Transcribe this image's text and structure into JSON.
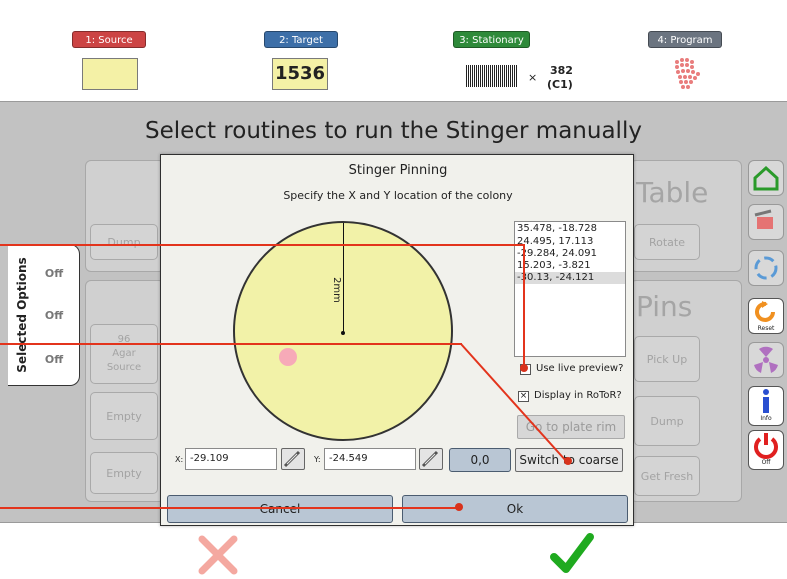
{
  "steps": [
    {
      "label": "1: Source",
      "color": "#cc4444"
    },
    {
      "label": "2: Target",
      "color": "#3d6fa8"
    },
    {
      "label": "3: Stationary",
      "color": "#2e8a3a"
    },
    {
      "label": "4: Program",
      "color": "#6b7480"
    }
  ],
  "target_plate_number": "1536",
  "stationary": {
    "multiplier": "×",
    "count": "382",
    "plate_ref": "(C1)"
  },
  "page_heading": "Select routines to run the Stinger manually",
  "background": {
    "dump": "Dump",
    "table": "Table",
    "rotate": "Rotate",
    "pins": "Pins",
    "agar_source_lines": [
      "96",
      "Agar",
      "Source"
    ],
    "pick_up": "Pick Up",
    "empty1": "Empty",
    "empty2": "Empty",
    "dump2": "Dump",
    "get_fresh": "Get Fresh"
  },
  "side_tab": {
    "label": "Selected Options",
    "icon_text": "Off"
  },
  "right_buttons": [
    "Home",
    "Transfer",
    "Color",
    "Reset",
    "Radiation",
    "Info",
    "Off"
  ],
  "dialog": {
    "title": "Stinger Pinning",
    "subtitle": "Specify the X and Y location of the colony",
    "plate_label": "2mm",
    "coordinates": [
      "35.478, -18.728",
      "24.495, 17.113",
      "-29.284, 24.091",
      "15.203, -3.821",
      "-30.13, -24.121"
    ],
    "selected_coordinate_index": 4,
    "live_preview_label": "Use live preview?",
    "live_preview_checked": false,
    "display_rotor_label": "Display in RoToR?",
    "display_rotor_checked": true,
    "go_to_plate_rim": "Go to plate rim",
    "x_label": "X:",
    "x_value": "-29.109",
    "y_label": "Y:",
    "y_value": "-24.549",
    "zero_button": "0,0",
    "switch_button": "Switch to coarse",
    "cancel_button": "Cancel",
    "ok_button": "Ok"
  },
  "colors": {
    "accent_red": "#e3341c",
    "plate_fill": "#f2f2a8",
    "ok_check": "#1faa1f",
    "cancel_x": "#f4a8a0"
  }
}
